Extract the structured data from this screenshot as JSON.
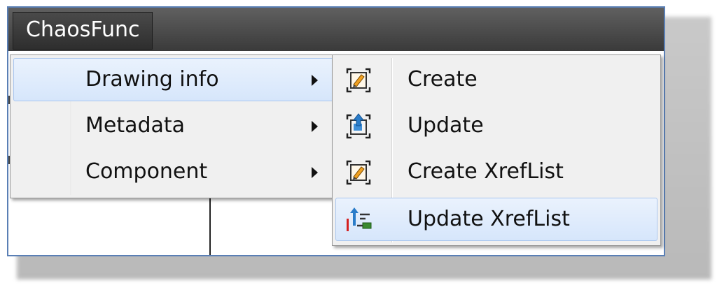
{
  "menubar": {
    "title": "ChaosFunc"
  },
  "main_menu": {
    "items": [
      {
        "label": "Drawing info",
        "icon": "none"
      },
      {
        "label": "Metadata",
        "icon": "none"
      },
      {
        "label": "Component",
        "icon": "none"
      }
    ]
  },
  "submenu": {
    "items": [
      {
        "label": "Create",
        "icon": "create-document-icon"
      },
      {
        "label": "Update",
        "icon": "update-document-icon"
      },
      {
        "label": "Create XrefList",
        "icon": "create-xreflist-icon"
      },
      {
        "label": "Update XrefList",
        "icon": "update-xreflist-icon"
      }
    ]
  },
  "colors": {
    "highlight": "#d6e6fb",
    "highlight_border": "#a9c6ef",
    "window_border": "#5a7fb5",
    "menu_bg": "#f0f0f0"
  }
}
